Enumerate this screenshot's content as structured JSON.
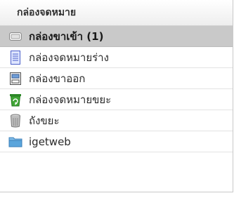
{
  "folders_panel": {
    "title": "กล่องจดหมาย",
    "items": [
      {
        "label": "กล่องขาเข้า (1)",
        "icon": "inbox-tray-icon",
        "selected": true
      },
      {
        "label": "กล่องจดหมายร่าง",
        "icon": "draft-document-icon",
        "selected": false
      },
      {
        "label": "กล่องขาออก",
        "icon": "outbox-icon",
        "selected": false
      },
      {
        "label": "กล่องจดหมายขยะ",
        "icon": "recycle-bin-icon",
        "selected": false
      },
      {
        "label": "ถังขยะ",
        "icon": "trash-can-icon",
        "selected": false
      },
      {
        "label": "igetweb",
        "icon": "folder-icon",
        "selected": false
      }
    ]
  },
  "colors": {
    "selected_background": "#c9c9c9",
    "recycle_green": "#3fa535",
    "folder_blue": "#5aa5dc"
  }
}
